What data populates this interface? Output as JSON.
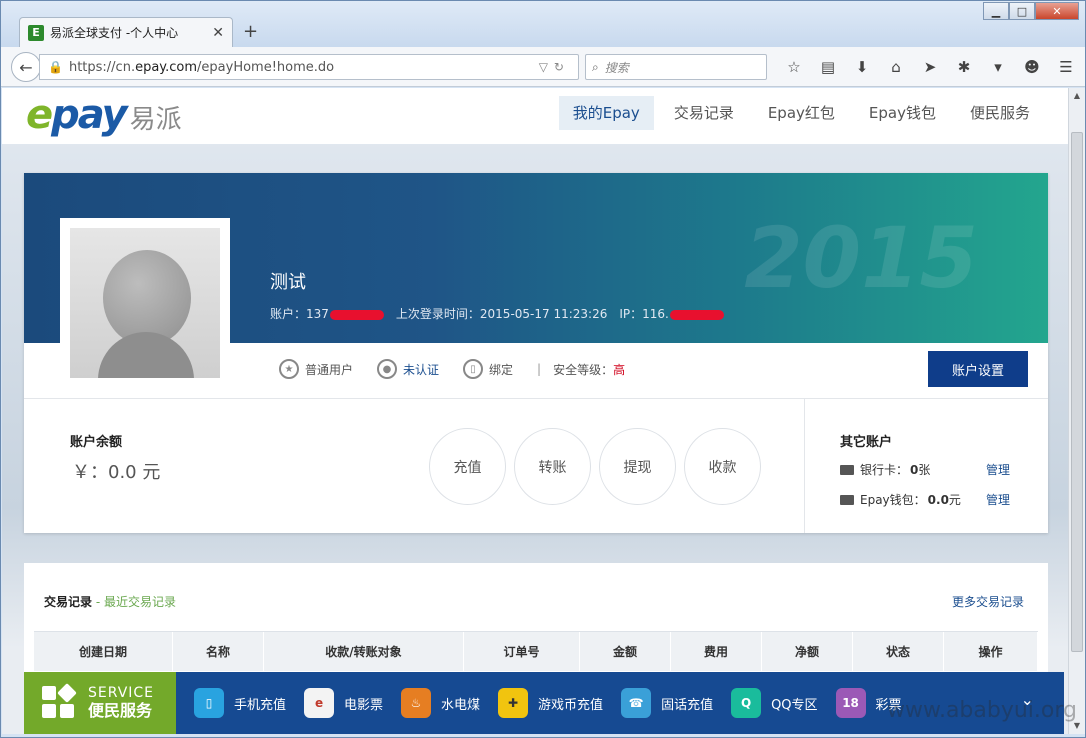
{
  "browser": {
    "tab_title": "易派全球支付 -个人中心",
    "url_prefix": "https://cn.",
    "url_domain": "epay.com",
    "url_path": "/epayHome!home.do",
    "search_placeholder": "搜索"
  },
  "header": {
    "logo_text": "易派",
    "nav": [
      "我的Epay",
      "交易记录",
      "Epay红包",
      "Epay钱包",
      "便民服务"
    ],
    "active_nav": "我的Epay"
  },
  "profile": {
    "name": "测试",
    "account_label": "账户：137",
    "last_login": "上次登录时间：2015-05-17 11:23:26",
    "ip_label": "IP：116.",
    "watermark_year": "2015",
    "badge_user": "普通用户",
    "badge_verify": "未认证",
    "badge_bind": "绑定",
    "security_label": "安全等级：",
    "security_level": "高",
    "settings_button": "账户设置"
  },
  "balance": {
    "label": "账户余额",
    "value": "￥：0.0 元",
    "actions": [
      "充值",
      "转账",
      "提现",
      "收款"
    ]
  },
  "other_accounts": {
    "title": "其它账户",
    "bank_label": "银行卡：",
    "bank_count": "0",
    "bank_unit": "张",
    "wallet_label": "Epay钱包：",
    "wallet_value": "0.0",
    "wallet_unit": "元",
    "manage": "管理"
  },
  "transactions": {
    "title": "交易记录",
    "subtitle": "- 最近交易记录",
    "more": "更多交易记录",
    "columns": [
      "创建日期",
      "名称",
      "收款/转账对象",
      "订单号",
      "金额",
      "费用",
      "净额",
      "状态",
      "操作"
    ]
  },
  "service_bar": {
    "title_en": "SERVICE",
    "title_cn": "便民服务",
    "items": [
      "手机充值",
      "电影票",
      "水电煤",
      "游戏币充值",
      "固话充值",
      "QQ专区",
      "彩票"
    ]
  },
  "watermark": "www.ababyui.org",
  "colors": {
    "brand_blue": "#1b4e8f",
    "brand_green": "#7fb52a",
    "button_blue": "#0f3d8a",
    "danger_red": "#d0021b"
  }
}
